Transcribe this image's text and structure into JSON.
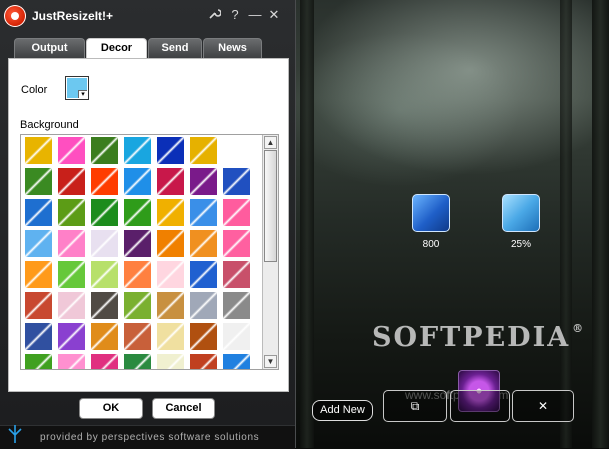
{
  "app": {
    "title": "JustResizeIt!+"
  },
  "titlebar_icons": {
    "wrench": "wrench-icon",
    "help": "?",
    "minimize": "—",
    "close": "✕"
  },
  "tabs": [
    {
      "label": "Output",
      "active": false
    },
    {
      "label": "Decor",
      "active": true
    },
    {
      "label": "Send",
      "active": false
    },
    {
      "label": "News",
      "active": false
    }
  ],
  "decor": {
    "color_label": "Color",
    "color_value": "#6cc8f0",
    "background_label": "Background"
  },
  "buttons": {
    "ok": "OK",
    "cancel": "Cancel"
  },
  "footer": {
    "text": "provided by perspectives software solutions"
  },
  "presets": [
    {
      "label": "800",
      "icon": "resize-size-icon",
      "color": "#2f7fd6"
    },
    {
      "label": "25%",
      "icon": "resize-percent-icon",
      "color": "#4aa8e6"
    }
  ],
  "right_toolbar": {
    "add_new": "Add New"
  },
  "watermark": {
    "brand": "SOFTPEDIA",
    "reg": "®",
    "url": "www.softpedia.com"
  },
  "tiles_colors": [
    [
      "#e8b400",
      "#ff4fc0",
      "#3b7d1e",
      "#19a6e0",
      "#0b2fb8",
      "#e6b100"
    ],
    [
      "#3a8a22",
      "#c8201a",
      "#ff3c00",
      "#1f8fe8",
      "#c8184a",
      "#7a1a8a",
      "#2050c0"
    ],
    [
      "#1e6fd0",
      "#5c9c16",
      "#1c8c1c",
      "#2f9c1a",
      "#f0b000",
      "#3a8fe8",
      "#ff5c9e"
    ],
    [
      "#5fb2f0",
      "#ff80c8",
      "#e8e0f0",
      "#5a1f6a",
      "#f08000",
      "#f09020",
      "#ff60a0"
    ],
    [
      "#ff9a1a",
      "#66c83a",
      "#b7e06a",
      "#ff8040",
      "#ffd6e0",
      "#2060d0",
      "#c8506a"
    ],
    [
      "#c84830",
      "#f0c8d8",
      "#504a44",
      "#7ab030",
      "#c89040",
      "#a0a8b8",
      "#8a8a8a"
    ],
    [
      "#3050a0",
      "#8a40d0",
      "#e08c1a",
      "#c8603a",
      "#f0e0a0",
      "#b05010",
      "#f0f0f0"
    ],
    [
      "#40a020",
      "#ff90d0",
      "#e03080",
      "#2a8a40",
      "#f0f0d0",
      "#c04020",
      "#2080e0"
    ]
  ]
}
